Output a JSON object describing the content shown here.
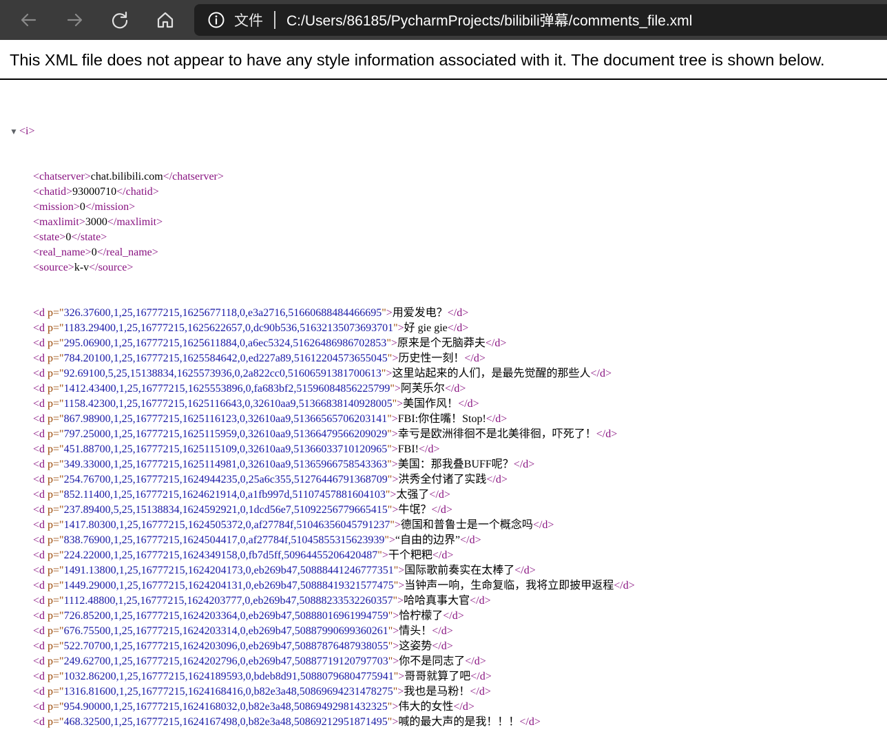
{
  "browser": {
    "address_scheme": "文件",
    "address_url": "C:/Users/86185/PycharmProjects/bilibili弹幕/comments_file.xml",
    "icons": [
      "back-arrow-icon",
      "forward-arrow-icon",
      "refresh-icon",
      "home-icon",
      "info-icon"
    ]
  },
  "notice": "This XML file does not appear to have any style information associated with it. The document tree is shown below.",
  "tree": {
    "root_open": "<i>",
    "simple": [
      {
        "tag": "chatserver",
        "text": "chat.bilibili.com"
      },
      {
        "tag": "chatid",
        "text": "93000710"
      },
      {
        "tag": "mission",
        "text": "0"
      },
      {
        "tag": "maxlimit",
        "text": "3000"
      },
      {
        "tag": "state",
        "text": "0"
      },
      {
        "tag": "real_name",
        "text": "0"
      },
      {
        "tag": "source",
        "text": "k-v"
      }
    ],
    "d": [
      {
        "p": "326.37600,1,25,16777215,1625677118,0,e3a2716,51660688484466695",
        "text": "用爱发电？"
      },
      {
        "p": "1183.29400,1,25,16777215,1625622657,0,dc90b536,51632135073693701",
        "text": "好 gie gie"
      },
      {
        "p": "295.06900,1,25,16777215,1625611884,0,a6ec5324,51626486986702853",
        "text": "原来是个无脑莽夫"
      },
      {
        "p": "784.20100,1,25,16777215,1625584642,0,ed227a89,51612204573655045",
        "text": "历史性一刻！"
      },
      {
        "p": "92.69100,5,25,15138834,1625573936,0,2a822cc0,51606591381700613",
        "text": "这里站起来的人们，是最先觉醒的那些人"
      },
      {
        "p": "1412.43400,1,25,16777215,1625553896,0,fa683bf2,51596084856225799",
        "text": "阿芙乐尔"
      },
      {
        "p": "1158.42300,1,25,16777215,1625116643,0,32610aa9,51366838140928005",
        "text": "美国作风！"
      },
      {
        "p": "867.98900,1,25,16777215,1625116123,0,32610aa9,51366565706203141",
        "text": "FBI:你住嘴！Stop!"
      },
      {
        "p": "797.25000,1,25,16777215,1625115959,0,32610aa9,51366479566209029",
        "text": "幸亏是欧洲徘徊不是北美徘徊，吓死了！"
      },
      {
        "p": "451.88700,1,25,16777215,1625115109,0,32610aa9,51366033710120965",
        "text": "FBI!"
      },
      {
        "p": "349.33000,1,25,16777215,1625114981,0,32610aa9,51365966758543363",
        "text": "美国：那我叠BUFF呢？"
      },
      {
        "p": "254.76700,1,25,16777215,1624944235,0,25a6c355,51276446791368709",
        "text": "洪秀全付诸了实践"
      },
      {
        "p": "852.11400,1,25,16777215,1624621914,0,a1fb997d,51107457881604103",
        "text": "太强了"
      },
      {
        "p": "237.89400,5,25,15138834,1624592921,0,1dcd56e7,51092256779665415",
        "text": "牛氓？"
      },
      {
        "p": "1417.80300,1,25,16777215,1624505372,0,af27784f,51046356045791237",
        "text": "德国和普鲁士是一个概念吗"
      },
      {
        "p": "838.76900,1,25,16777215,1624504417,0,af27784f,51045855315623939",
        "text": "“自由的边界”"
      },
      {
        "p": "224.22000,1,25,16777215,1624349158,0,fb7d5ff,50964455206420487",
        "text": "干个粑粑"
      },
      {
        "p": "1491.13800,1,25,16777215,1624204173,0,eb269b47,50888441246777351",
        "text": "国际歌前奏实在太棒了"
      },
      {
        "p": "1449.29000,1,25,16777215,1624204131,0,eb269b47,50888419321577475",
        "text": "当钟声一响，生命复临，我将立即披甲返程"
      },
      {
        "p": "1112.48800,1,25,16777215,1624203777,0,eb269b47,50888233532260357",
        "text": "哈哈真事大官"
      },
      {
        "p": "726.85200,1,25,16777215,1624203364,0,eb269b47,50888016961994759",
        "text": "恰柠檬了"
      },
      {
        "p": "676.75500,1,25,16777215,1624203314,0,eb269b47,50887990699360261",
        "text": "情头！"
      },
      {
        "p": "522.70700,1,25,16777215,1624203096,0,eb269b47,50887876487938055",
        "text": "这姿势"
      },
      {
        "p": "249.62700,1,25,16777215,1624202796,0,eb269b47,50887719120797703",
        "text": "你不是同志了"
      },
      {
        "p": "1032.86200,1,25,16777215,1624189593,0,bdeb8d91,50880796804775941",
        "text": "哥哥就算了吧"
      },
      {
        "p": "1316.81600,1,25,16777215,1624168416,0,b82e3a48,50869694231478275",
        "text": "我也是马粉！"
      },
      {
        "p": "954.90000,1,25,16777215,1624168032,0,b82e3a48,50869492981432325",
        "text": "伟大的女性"
      },
      {
        "p": "468.32500,1,25,16777215,1624167498,0,b82e3a48,50869212951871495",
        "text": "喊的最大声的是我！！！"
      }
    ]
  }
}
